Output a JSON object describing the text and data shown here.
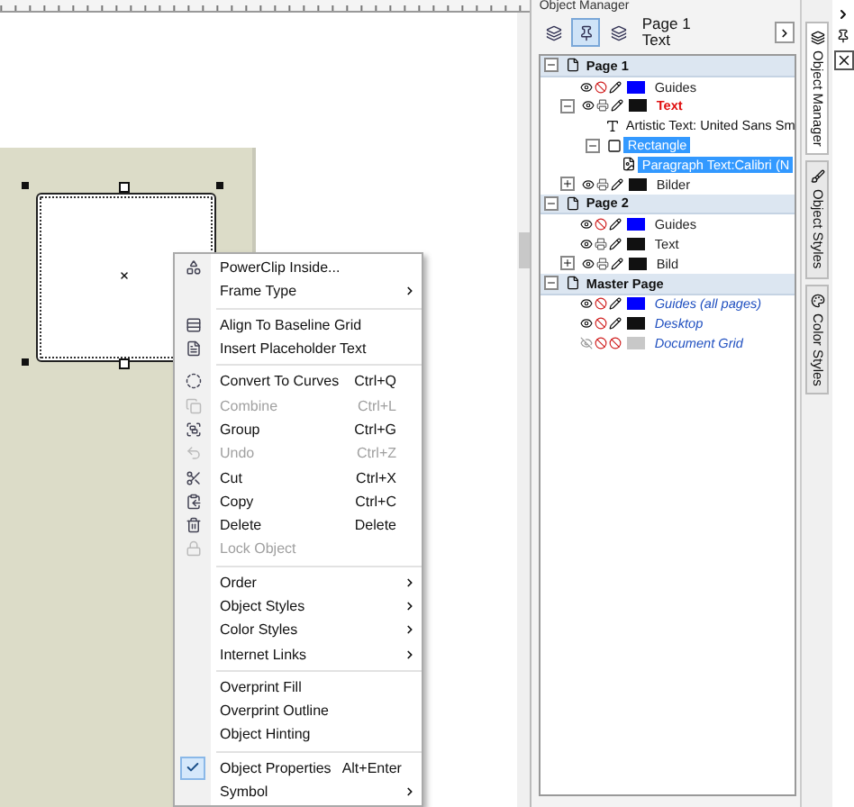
{
  "context_menu": {
    "items": [
      {
        "kind": "item",
        "label": "PowerClip Inside...",
        "submenu": false,
        "disabled": false,
        "checked": false
      },
      {
        "kind": "item",
        "label": "Frame Type",
        "submenu": true,
        "disabled": false,
        "checked": false
      },
      {
        "kind": "separator"
      },
      {
        "kind": "item",
        "label": "Align To Baseline Grid",
        "submenu": false,
        "disabled": false,
        "checked": false
      },
      {
        "kind": "item",
        "label": "Insert Placeholder Text",
        "submenu": false,
        "disabled": false,
        "checked": false
      },
      {
        "kind": "separator"
      },
      {
        "kind": "item",
        "label": "Convert To Curves",
        "shortcut": "Ctrl+Q",
        "submenu": false,
        "disabled": false,
        "checked": false
      },
      {
        "kind": "item",
        "label": "Combine",
        "shortcut": "Ctrl+L",
        "submenu": false,
        "disabled": true,
        "checked": false
      },
      {
        "kind": "item",
        "label": "Group",
        "shortcut": "Ctrl+G",
        "submenu": false,
        "disabled": false,
        "checked": false
      },
      {
        "kind": "item",
        "label": "Undo",
        "shortcut": "Ctrl+Z",
        "submenu": false,
        "disabled": true,
        "checked": false
      },
      {
        "kind": "item",
        "label": "Cut",
        "shortcut": "Ctrl+X",
        "submenu": false,
        "disabled": false,
        "checked": false
      },
      {
        "kind": "item",
        "label": "Copy",
        "shortcut": "Ctrl+C",
        "submenu": false,
        "disabled": false,
        "checked": false
      },
      {
        "kind": "item",
        "label": "Delete",
        "shortcut": "Delete",
        "submenu": false,
        "disabled": false,
        "checked": false
      },
      {
        "kind": "item",
        "label": "Lock Object",
        "submenu": false,
        "disabled": true,
        "checked": false
      },
      {
        "kind": "separator"
      },
      {
        "kind": "item",
        "label": "Order",
        "submenu": true,
        "disabled": false,
        "checked": false
      },
      {
        "kind": "item",
        "label": "Object Styles",
        "submenu": true,
        "disabled": false,
        "checked": false
      },
      {
        "kind": "item",
        "label": "Color Styles",
        "submenu": true,
        "disabled": false,
        "checked": false
      },
      {
        "kind": "item",
        "label": "Internet Links",
        "submenu": true,
        "disabled": false,
        "checked": false
      },
      {
        "kind": "separator"
      },
      {
        "kind": "item",
        "label": "Overprint Fill",
        "submenu": false,
        "disabled": false,
        "checked": false
      },
      {
        "kind": "item",
        "label": "Overprint Outline",
        "submenu": false,
        "disabled": false,
        "checked": false
      },
      {
        "kind": "item",
        "label": "Object Hinting",
        "submenu": false,
        "disabled": false,
        "checked": false
      },
      {
        "kind": "separator"
      },
      {
        "kind": "item",
        "label": "Object Properties",
        "shortcut": "Alt+Enter",
        "submenu": false,
        "disabled": false,
        "checked": true
      },
      {
        "kind": "item",
        "label": "Symbol",
        "submenu": true,
        "disabled": false,
        "checked": false
      }
    ]
  },
  "object_manager": {
    "title": "Object Manager",
    "toolbar": {
      "tools": [
        {
          "selected": false
        },
        {
          "selected": true
        },
        {
          "selected": false
        }
      ],
      "page": "Page 1",
      "layer": "Text"
    },
    "pages": [
      {
        "name": "Page 1",
        "kind": "page",
        "expanded": true,
        "layers": [
          {
            "name": "Guides",
            "visible": true,
            "printable": false,
            "editable": true,
            "color": "#0000ff",
            "active": false,
            "selected": false
          },
          {
            "name": "Text",
            "visible": true,
            "printable": true,
            "editable": true,
            "color": "#111111",
            "active": true,
            "selected": false,
            "expanded": true,
            "children": [
              {
                "name": "Artistic Text: United Sans Sm",
                "kind": "artistic-text",
                "selected": false
              },
              {
                "name": "Rectangle",
                "kind": "rectangle",
                "selected": true,
                "expanded": true,
                "children": [
                  {
                    "name": "Paragraph Text:Calibri (N",
                    "kind": "paragraph-text",
                    "selected": true
                  }
                ]
              }
            ]
          },
          {
            "name": "Bilder",
            "visible": true,
            "printable": true,
            "editable": true,
            "color": "#111111",
            "active": false,
            "selected": false,
            "expanded": false
          }
        ]
      },
      {
        "name": "Page 2",
        "kind": "page",
        "expanded": true,
        "layers": [
          {
            "name": "Guides",
            "visible": true,
            "printable": false,
            "editable": true,
            "color": "#0000ff",
            "active": false,
            "selected": false
          },
          {
            "name": "Text",
            "visible": true,
            "printable": true,
            "editable": true,
            "color": "#111111",
            "active": false,
            "selected": false
          },
          {
            "name": "Bild",
            "visible": true,
            "printable": true,
            "editable": true,
            "color": "#111111",
            "active": false,
            "selected": false,
            "expanded": false
          }
        ]
      },
      {
        "name": "Master Page",
        "kind": "master",
        "expanded": true,
        "layers": [
          {
            "name": "Guides (all pages)",
            "visible": true,
            "printable": false,
            "editable": true,
            "color": "#0000ff",
            "active": false,
            "selected": false
          },
          {
            "name": "Desktop",
            "visible": true,
            "printable": false,
            "editable": true,
            "color": "#111111",
            "active": false,
            "selected": false
          },
          {
            "name": "Document Grid",
            "visible": false,
            "printable": false,
            "editable": false,
            "color": "#c8c8c8",
            "active": false,
            "selected": false
          }
        ]
      }
    ]
  },
  "docker_tabs": [
    {
      "label": "Object Manager",
      "selected": true
    },
    {
      "label": "Object Styles",
      "selected": false
    },
    {
      "label": "Color Styles",
      "selected": false
    }
  ]
}
